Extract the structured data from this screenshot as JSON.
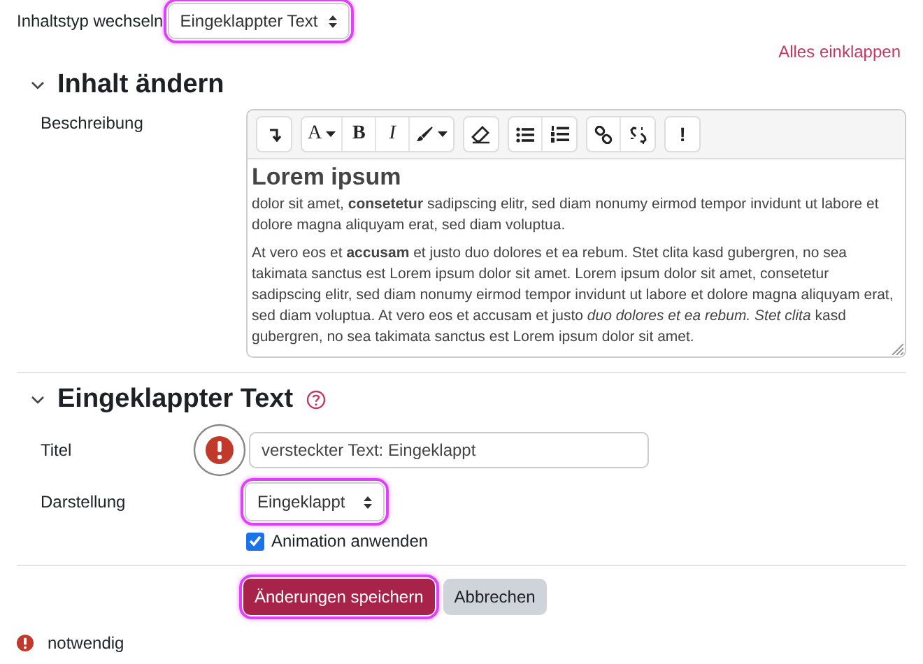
{
  "content_type": {
    "label": "Inhaltstyp wechseln",
    "value": "Eingeklappter Text",
    "highlighted": true
  },
  "collapse_all_link": "Alles einklappen",
  "edit_section": {
    "title": "Inhalt ändern",
    "expanded": true,
    "editor": {
      "label": "Beschreibung",
      "toolbar": [
        [
          {
            "kind": "collapse"
          }
        ],
        [
          {
            "kind": "font",
            "label": "A",
            "dropdown": true
          },
          {
            "kind": "bold",
            "label": "B",
            "dropdown": false
          },
          {
            "kind": "italic",
            "label": "I",
            "dropdown": false
          },
          {
            "kind": "brush",
            "dropdown": true
          }
        ],
        [
          {
            "kind": "eraser"
          }
        ],
        [
          {
            "kind": "bullets"
          },
          {
            "kind": "numbers"
          }
        ],
        [
          {
            "kind": "link"
          },
          {
            "kind": "unlink"
          }
        ],
        [
          {
            "kind": "important",
            "label": "!",
            "dropdown": false
          }
        ]
      ],
      "heading": "Lorem ipsum",
      "paragraphs": [
        "dolor sit amet, **consetetur** sadipscing elitr, sed diam nonumy eirmod tempor invidunt ut labore et dolore magna aliquyam erat, sed diam voluptua.",
        "At vero eos et **accusam** et justo duo dolores et ea rebum. Stet clita kasd gubergren, no sea takimata sanctus est Lorem ipsum dolor sit amet. Lorem ipsum dolor sit amet, consetetur sadipscing elitr, sed diam nonumy eirmod tempor invidunt ut labore et dolore magna aliquyam erat, sed diam voluptua. At vero eos et accusam et justo *duo dolores et ea rebum. Stet clita* kasd gubergren, no sea takimata sanctus est Lorem ipsum dolor sit amet."
      ]
    }
  },
  "collapsed_section": {
    "title": "Eingeklappter Text",
    "expanded": true,
    "help": true,
    "title_field": {
      "label": "Titel",
      "value": "versteckter Text: Eingeklappt",
      "required": true
    },
    "display_field": {
      "label": "Darstellung",
      "value": "Eingeklappt",
      "highlighted": true
    },
    "animation": {
      "label": "Animation anwenden",
      "checked": true
    }
  },
  "buttons": [
    {
      "label": "Änderungen speichern",
      "kind": "primary",
      "highlighted": true
    },
    {
      "label": "Abbrechen",
      "kind": "secondary",
      "highlighted": false
    }
  ],
  "required_note": "notwendig"
}
